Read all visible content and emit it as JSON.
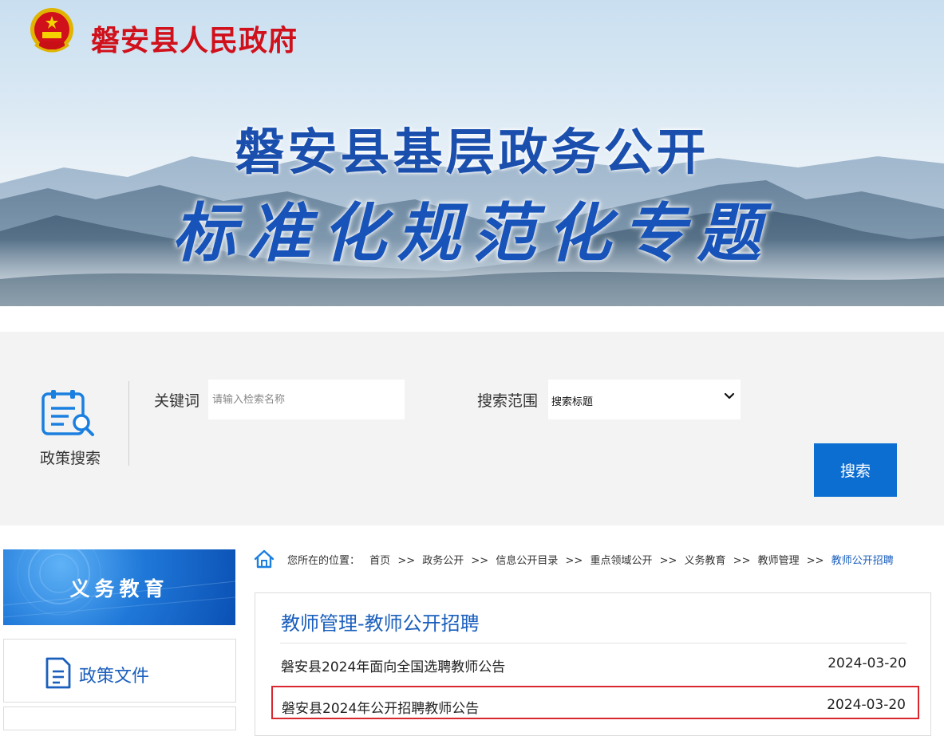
{
  "header": {
    "site_title": "磐安县人民政府",
    "banner_line_1": "磐安县基层政务公开",
    "banner_line_2": "标准化规范化专题",
    "emblem_icon": "national-emblem-icon"
  },
  "search": {
    "section_label": "政策搜索",
    "section_icon": "policy-search-icon",
    "keyword_label": "关键词",
    "keyword_placeholder": "请输入检索名称",
    "keyword_value": "",
    "scope_label": "搜索范围",
    "scope_selected": "搜索标题",
    "button_label": "搜索"
  },
  "sidebar": {
    "header": "义务教育",
    "items": [
      {
        "label": "政策文件",
        "icon": "document-icon"
      }
    ]
  },
  "breadcrumb": {
    "prefix": "您所在的位置：",
    "items": [
      "首页",
      "政务公开",
      "信息公开目录",
      "重点领域公开",
      "义务教育",
      "教师管理",
      "教师公开招聘"
    ],
    "separator": ">>"
  },
  "list": {
    "title": "教师管理-教师公开招聘",
    "rows": [
      {
        "title": "磐安县2024年面向全国选聘教师公告",
        "date": "2024-03-20"
      },
      {
        "title": "磐安县2024年公开招聘教师公告",
        "date": "2024-03-20",
        "highlighted": true
      }
    ]
  },
  "colors": {
    "brand_red": "#d0101a",
    "accent_blue": "#1b5fbd",
    "button_blue": "#0d6ed1",
    "highlight_border": "#d9262f"
  }
}
